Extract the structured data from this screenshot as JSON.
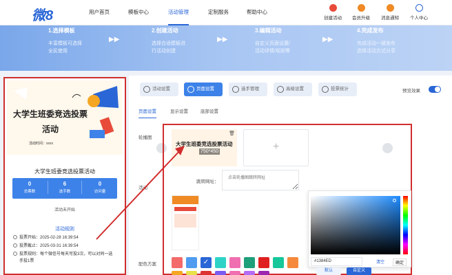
{
  "header": {
    "logo": "微8",
    "nav": [
      "用户首页",
      "模板中心",
      "活动管理",
      "定制服务",
      "帮助中心"
    ],
    "active_nav": "活动管理",
    "right_items": [
      {
        "label": "创建活动",
        "icon": "create-activity-icon",
        "color": "#e84b3a"
      },
      {
        "label": "会员升级",
        "icon": "vip-upgrade-icon",
        "color": "#f08a24"
      },
      {
        "label": "消息通知",
        "icon": "notification-icon",
        "color": "#f08a24"
      },
      {
        "label": "个人中心",
        "icon": "user-center-icon",
        "color": "#2a66d6"
      }
    ]
  },
  "steps": [
    {
      "title": "1.选择模板",
      "desc": [
        "丰富模板可选择",
        "全民使用"
      ]
    },
    {
      "title": "2.创建活动",
      "desc": [
        "选择合适模板进",
        "行活动创建"
      ]
    },
    {
      "title": "3.编辑活动",
      "desc": [
        "自定义页面设置/",
        "活动详情/规则等"
      ]
    },
    {
      "title": "4.完成发布",
      "desc": [
        "完成活动一键发布",
        "选择活动方式分享"
      ]
    }
  ],
  "preview": {
    "poster_title": "大学生班委竞选投票活动",
    "poster_time": "活动时间：xxxx",
    "card_title": "大学生班委竞选投票活动",
    "stats": [
      {
        "value": "0",
        "label": "总票数"
      },
      {
        "value": "6",
        "label": "选手数"
      },
      {
        "value": "0",
        "label": "访问量"
      }
    ],
    "status": "活动未开始",
    "rules_title": "活动规则",
    "rules": [
      "投票开始：2025-02-28 16:39:54",
      "投票截止：2025-03-31 16:39:54",
      "投票规则：每个微信号每天可投3次，可以对同一选手投1票"
    ]
  },
  "toolbar": [
    "活动设置",
    "页面设置",
    "选手管理",
    "高级设置",
    "投票统计"
  ],
  "active_tool": "页面设置",
  "preview_toggle_label": "预览效果",
  "subtabs": [
    "页面设置",
    "显示设置",
    "底部设置"
  ],
  "active_subtab": "页面设置",
  "form": {
    "carousel_label": "轮播图",
    "thumb_title": "大学生班委竞选投票活动",
    "thumb_size": "750*450",
    "activity_label": "活动",
    "url_label": "跳转网址：",
    "url_placeholder": "点击轮播图跳转网址",
    "color_label": "配色方案"
  },
  "swatch_colors": [
    "#f46a6a",
    "#4f9cf0",
    "#2a66d6",
    "#2ed3c6",
    "#f06fb0",
    "#1f9f7a",
    "#e02020",
    "#16c79a",
    "#f58a3c",
    "#d9d9d9"
  ],
  "swatch_colors_row2": [
    "#f5a623",
    "#e8e14a",
    "#d33",
    "#7a5cf0",
    "#f06fb0",
    "#b56cf5",
    "#9c27b0"
  ],
  "color_picker": {
    "hex": "#1384ED",
    "clear_label": "清空",
    "confirm_label": "确定"
  },
  "bottom_buttons": {
    "default": "默认",
    "custom": "自定义"
  }
}
